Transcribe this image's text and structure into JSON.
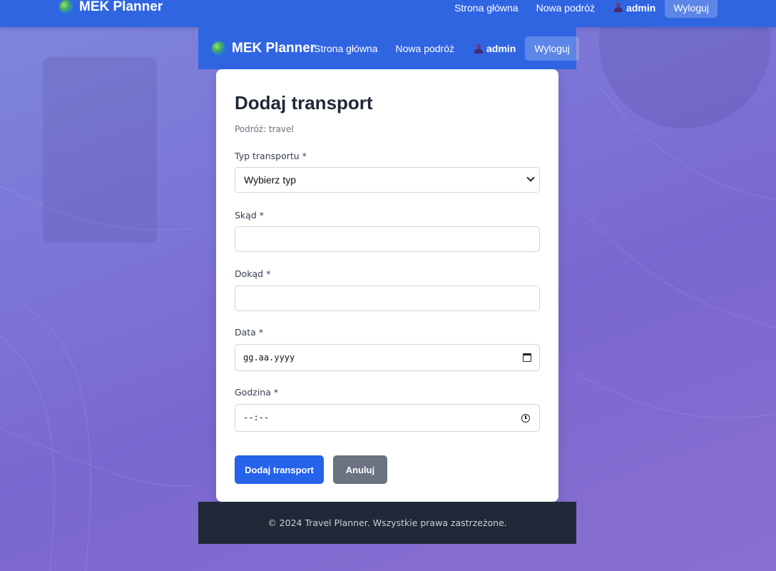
{
  "app": {
    "brand": "MEK Planner"
  },
  "top_nav": {
    "home": "Strona główna",
    "new_trip": "Nowa podróż",
    "user": "admin",
    "logout": "Wyloguj"
  },
  "inner_nav": {
    "home": "Strona główna",
    "new_trip": "Nowa podróż",
    "user": "admin",
    "logout": "Wyloguj"
  },
  "form": {
    "title": "Dodaj transport",
    "trip_label": "Podróż: travel",
    "type": {
      "label": "Typ transportu *",
      "value": "Wybierz typ"
    },
    "from": {
      "label": "Skąd *",
      "value": ""
    },
    "to": {
      "label": "Dokąd *",
      "value": ""
    },
    "date": {
      "label": "Data *",
      "placeholder": "gg.aa.yyyy"
    },
    "time": {
      "label": "Godzina *",
      "placeholder": "--:--"
    },
    "submit": "Dodaj transport",
    "cancel": "Anuluj"
  },
  "footer": {
    "text": "© 2024 Travel Planner. Wszystkie prawa zastrzeżone."
  },
  "colors": {
    "nav_blue": "#3065e2",
    "primary_button": "#2563eb",
    "secondary_button": "#6b7280",
    "footer_bg": "#1f2937"
  }
}
